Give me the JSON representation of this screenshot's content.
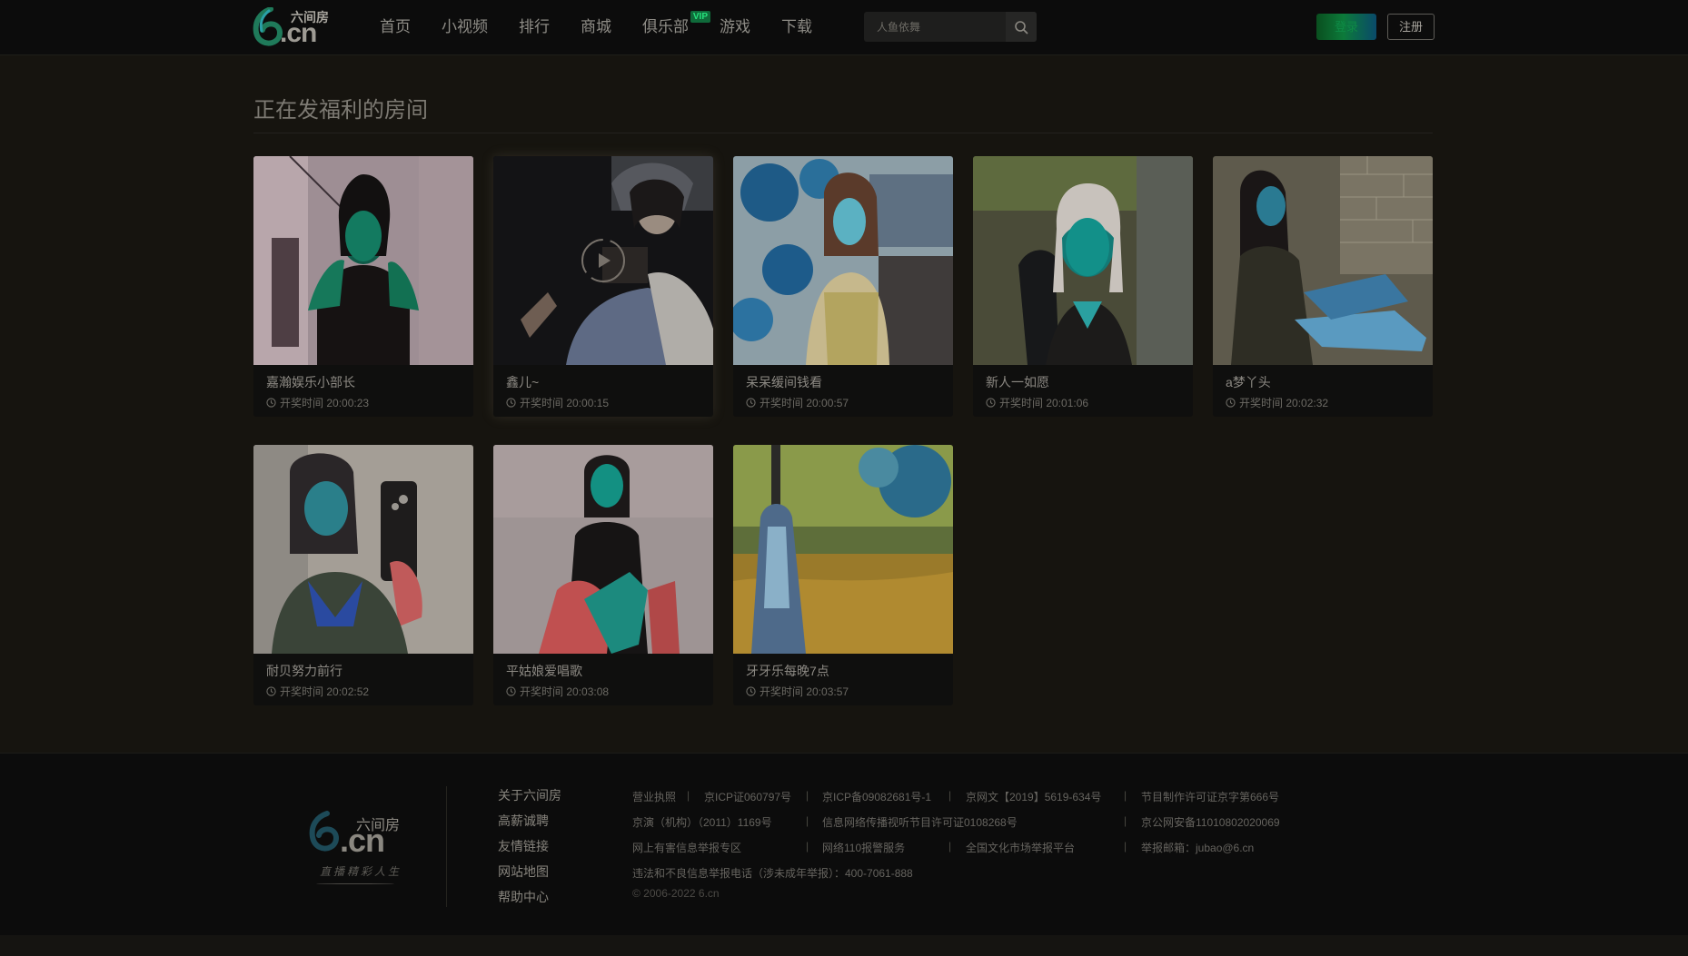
{
  "header": {
    "logo_text": "六间房",
    "logo_domain": ".cn",
    "nav": [
      {
        "label": "首页"
      },
      {
        "label": "小视频"
      },
      {
        "label": "排行"
      },
      {
        "label": "商城"
      },
      {
        "label": "俱乐部",
        "badge": "VIP"
      },
      {
        "label": "游戏"
      },
      {
        "label": "下载"
      }
    ],
    "search": {
      "placeholder": "人鱼依舞"
    },
    "login_label": "登录",
    "register_label": "注册"
  },
  "main": {
    "section_title": "正在发福利的房间",
    "time_prefix": "开奖时间",
    "rooms": [
      {
        "name": "嘉瀚娱乐小部长",
        "time": "20:00:23"
      },
      {
        "name": "鑫儿~",
        "time": "20:00:15"
      },
      {
        "name": "呆呆缓间钱看",
        "time": "20:00:57"
      },
      {
        "name": "新人一如愿",
        "time": "20:01:06"
      },
      {
        "name": "a梦丫头",
        "time": "20:02:32"
      },
      {
        "name": "耐贝努力前行",
        "time": "20:02:52"
      },
      {
        "name": "平姑娘爱唱歌",
        "time": "20:03:08"
      },
      {
        "name": "牙牙乐每晚7点",
        "time": "20:03:57"
      }
    ]
  },
  "footer": {
    "logo_text": "六间房",
    "logo_domain": ".cn",
    "logo_slogan": "直播精彩人生",
    "links": [
      "关于六间房",
      "高薪诚聘",
      "友情链接",
      "网站地图",
      "帮助中心"
    ],
    "info": {
      "r1": [
        "营业执照",
        "京ICP证060797号",
        "京ICP备09082681号-1",
        "京网文【2019】5619-634号",
        "节目制作许可证京字第666号"
      ],
      "r2": [
        "京演（机构）（2011）1169号",
        "信息网络传播视听节目许可证0108268号",
        "京公网安备11010802020069"
      ],
      "r3": [
        "网上有害信息举报专区",
        "网络110报警服务",
        "全国文化市场举报平台",
        "举报邮箱：jubao@6.cn"
      ],
      "r4": "违法和不良信息举报电话（涉未成年举报）：400-7061-888",
      "copyright": "© 2006-2022 6.cn"
    }
  },
  "colors": {
    "background": "#16140f",
    "header_bg": "#0c0c0c",
    "vip_green": "#26e07c",
    "login_gradient_start": "#0a4f1f",
    "login_gradient_end": "#0a4a6a"
  }
}
